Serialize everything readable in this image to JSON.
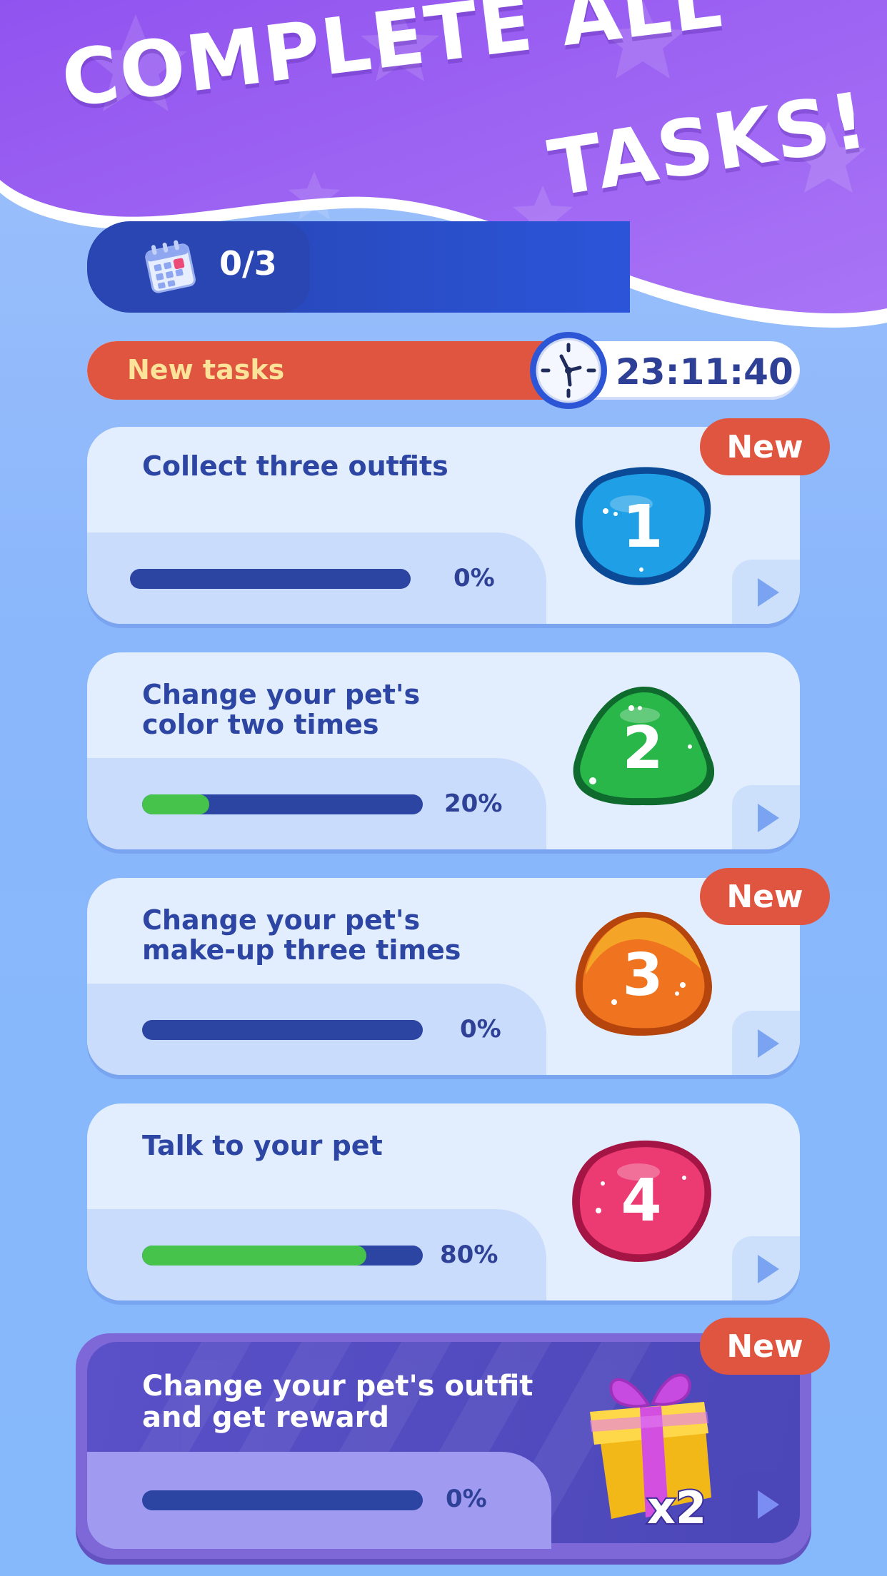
{
  "header": {
    "title_line1": "COMPLETE ALL",
    "title_line2": "TASKS!",
    "progress_count": "0/3"
  },
  "timer": {
    "label": "New tasks",
    "value": "23:11:40"
  },
  "tasks": [
    {
      "title": "Collect three outfits",
      "progress_text": "0%",
      "progress": 0,
      "number": "1",
      "badge": "New",
      "color": "#1e9fe6"
    },
    {
      "title": "Change your pet's\ncolor  two times",
      "progress_text": "20%",
      "progress": 0.2,
      "number": "2",
      "badge": "",
      "color": "#29b74a"
    },
    {
      "title": "Change your pet's\nmake-up three times",
      "progress_text": "0%",
      "progress": 0,
      "number": "3",
      "badge": "New",
      "color": "#f0741f"
    },
    {
      "title": "Talk to your pet",
      "progress_text": "80%",
      "progress": 0.8,
      "number": "4",
      "badge": "",
      "color": "#ec3a72"
    }
  ],
  "reward_task": {
    "title": "Change your pet's outfit\nand get reward",
    "progress_text": "0%",
    "progress": 0,
    "badge": "New",
    "multiplier": "x2"
  },
  "colors": {
    "header_purple": "#9c5cf2",
    "accent_red": "#e0553f",
    "navy": "#2e46a3",
    "progress_green": "#45c34b"
  },
  "icons": [
    "calendar-icon",
    "clock-icon",
    "play-arrow-icon",
    "gift-icon"
  ]
}
